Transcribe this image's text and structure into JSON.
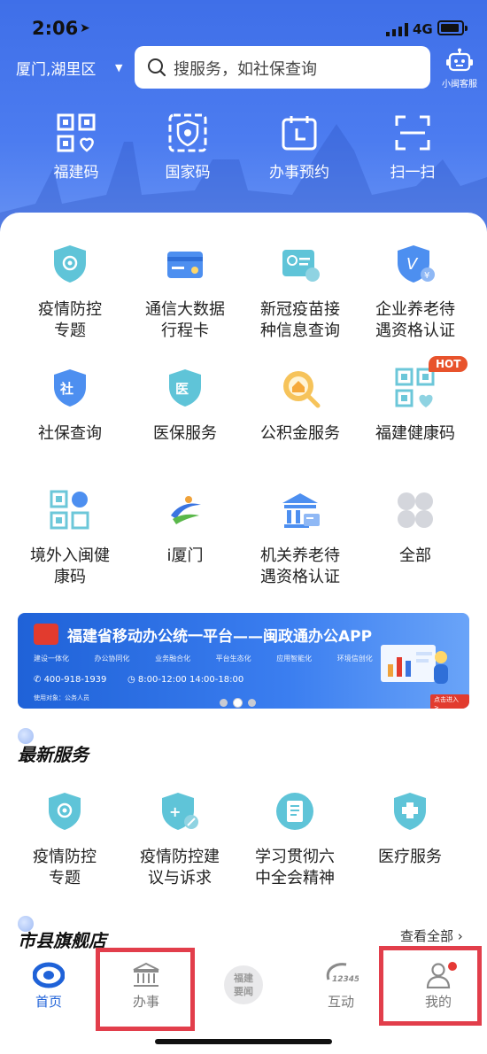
{
  "status_bar": {
    "time": "2:06",
    "network": "4G"
  },
  "header": {
    "location": "厦门,湖里区",
    "search_placeholder": "搜服务，如社保查询",
    "service_label": "小闽客服",
    "quick_actions": [
      {
        "label": "福建码",
        "icon": "qr-health-code-icon"
      },
      {
        "label": "国家码",
        "icon": "national-code-icon"
      },
      {
        "label": "办事预约",
        "icon": "calendar-icon"
      },
      {
        "label": "扫一扫",
        "icon": "scan-icon"
      }
    ]
  },
  "services": [
    {
      "label": "疫情防控\n专题",
      "icon": "shield-virus-icon"
    },
    {
      "label": "通信大数据\n行程卡",
      "icon": "card-icon"
    },
    {
      "label": "新冠疫苗接\n种信息查询",
      "icon": "vaccine-card-icon"
    },
    {
      "label": "企业养老待\n遇资格认证",
      "icon": "v-shield-icon"
    },
    {
      "label": "社保查询",
      "icon": "social-security-icon"
    },
    {
      "label": "医保服务",
      "icon": "medical-insurance-icon"
    },
    {
      "label": "公积金服务",
      "icon": "housing-fund-icon"
    },
    {
      "label": "福建健康码",
      "icon": "health-qr-icon"
    },
    {
      "label": "境外入闽健\n康码",
      "icon": "globe-qr-icon"
    },
    {
      "label": "i厦门",
      "icon": "i-xiamen-icon"
    },
    {
      "label": "机关养老待\n遇资格认证",
      "icon": "government-building-icon"
    },
    {
      "label": "全部",
      "icon": "all-grid-icon"
    }
  ],
  "hot_badge": "HOT",
  "banner": {
    "title": "福建省移动办公统一平台——闽政通办公APP",
    "tags": [
      "建设一体化",
      "办公协同化",
      "业务融合化",
      "平台生态化",
      "应用智能化",
      "环境信创化"
    ],
    "phone": "400-918-1939",
    "hours": "8:00-12:00 14:00-18:00",
    "target": "使用对象：公务人员",
    "enter": "点击进入 >"
  },
  "latest": {
    "title": "最新服务",
    "items": [
      {
        "label": "疫情防控\n专题",
        "icon": "shield-virus-icon"
      },
      {
        "label": "疫情防控建\n议与诉求",
        "icon": "shield-edit-icon"
      },
      {
        "label": "学习贯彻六\n中全会精神",
        "icon": "document-icon"
      },
      {
        "label": "医疗服务",
        "icon": "medical-cross-icon"
      }
    ]
  },
  "stores": {
    "title": "市县旗舰店",
    "view_all": "查看全部 ›"
  },
  "tabbar": [
    {
      "label": "首页",
      "icon": "home-logo-icon"
    },
    {
      "label": "办事",
      "icon": "bank-building-icon"
    },
    {
      "label": "福建\n要闻",
      "icon": "news-seal-icon"
    },
    {
      "label": "互动",
      "icon": "hotline-12345-icon",
      "icon_text": "12345"
    },
    {
      "label": "我的",
      "icon": "user-icon"
    }
  ],
  "colors": {
    "primary": "#1f62d8",
    "header": "#4c7cf0",
    "highlight_box": "#e23e4b",
    "hot": "#e8532c"
  }
}
